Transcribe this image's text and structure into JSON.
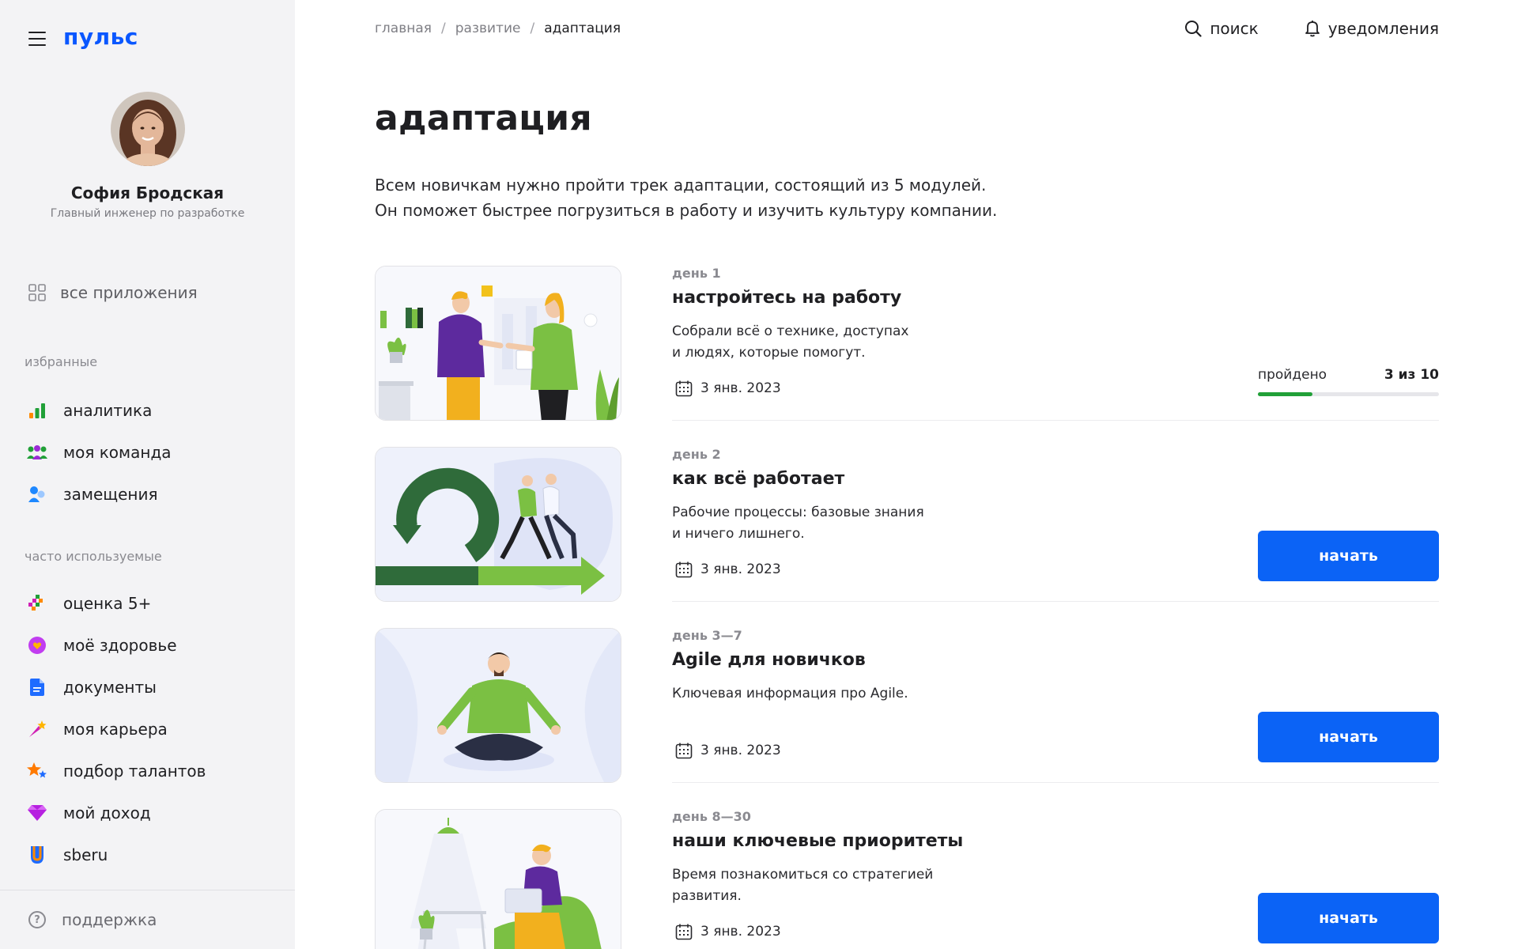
{
  "app": {
    "logo": "пульс"
  },
  "profile": {
    "name": "София Бродская",
    "role": "Главный инженер по разработке"
  },
  "sidebar": {
    "all_apps": "все приложения",
    "favorites_label": "избранные",
    "favorites": [
      {
        "label": "аналитика",
        "icon": "analytics-icon"
      },
      {
        "label": "моя команда",
        "icon": "team-icon"
      },
      {
        "label": "замещения",
        "icon": "substitution-icon"
      }
    ],
    "frequent_label": "часто используемые",
    "frequent": [
      {
        "label": "оценка 5+",
        "icon": "rating-icon"
      },
      {
        "label": "моё здоровье",
        "icon": "health-icon"
      },
      {
        "label": "документы",
        "icon": "document-icon"
      },
      {
        "label": "моя карьера",
        "icon": "career-icon"
      },
      {
        "label": "подбор талантов",
        "icon": "talent-icon"
      },
      {
        "label": "мой доход",
        "icon": "income-icon"
      },
      {
        "label": "sberu",
        "icon": "sberu-icon"
      }
    ],
    "support": "поддержка"
  },
  "header": {
    "breadcrumb": [
      "главная",
      "развитие",
      "адаптация"
    ],
    "search": "поиск",
    "notifications": "уведомления"
  },
  "page": {
    "title": "адаптация",
    "intro_line1": "Всем новичкам нужно пройти трек адаптации, состоящий из 5 модулей.",
    "intro_line2": "Он поможет быстрее погрузиться в работу и изучить культуру компании."
  },
  "modules": [
    {
      "day": "день 1",
      "title": "настройтесь на работу",
      "desc_line1": "Собрали всё о технике, доступах",
      "desc_line2": "и людях, которые помогут.",
      "date": "3 янв. 2023",
      "progress_label": "пройдено",
      "progress_count": "3 из 10",
      "progress_fraction": 0.3
    },
    {
      "day": "день 2",
      "title": "как всё работает",
      "desc_line1": "Рабочие процессы: базовые знания",
      "desc_line2": "и ничего лишнего.",
      "date": "3 янв. 2023",
      "button": "начать"
    },
    {
      "day": "день 3—7",
      "title": "Agile для новичков",
      "desc_line1": "Ключевая информация про Agile.",
      "desc_line2": "",
      "date": "3 янв. 2023",
      "button": "начать"
    },
    {
      "day": "день 8—30",
      "title": "наши ключевые приоритеты",
      "desc_line1": "Время познакомиться со стратегией",
      "desc_line2": "развития.",
      "date": "3 янв. 2023",
      "button": "начать"
    }
  ],
  "colors": {
    "brand": "#0a57ff",
    "button": "#0b63f6",
    "progress": "#21a038",
    "sidebar_bg": "#f3f3f5"
  }
}
